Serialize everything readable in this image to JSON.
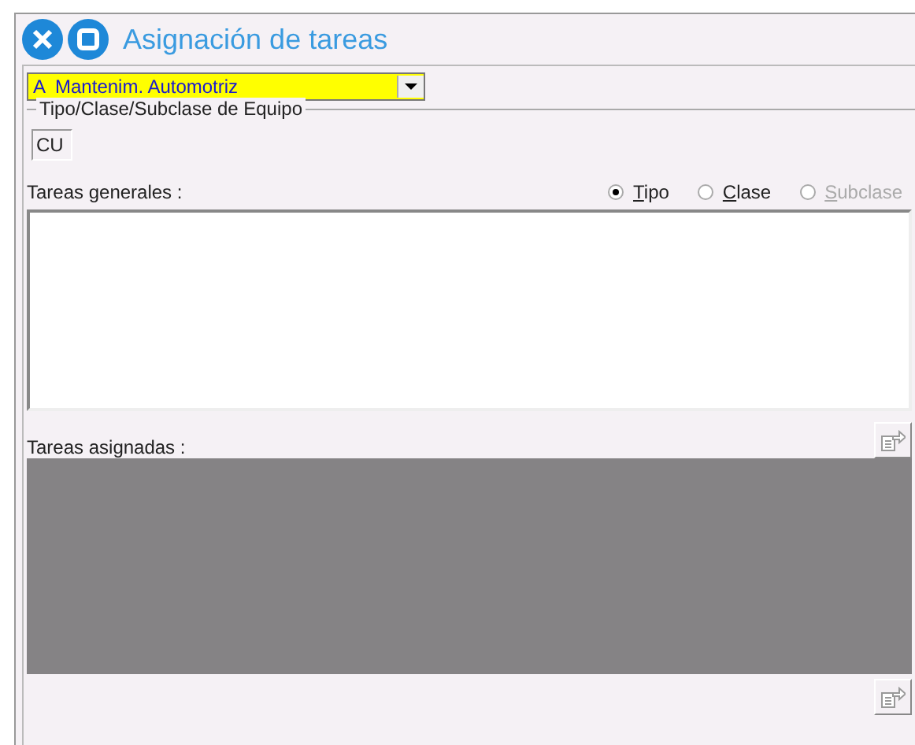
{
  "window": {
    "title": "Asignación de tareas"
  },
  "dropdown": {
    "value": "A  Mantenim. Automotriz"
  },
  "equipment_group": {
    "label": "Tipo/Clase/Subclase de Equipo",
    "value": "CU"
  },
  "general_tasks": {
    "label": "Tareas generales :"
  },
  "radios": [
    {
      "label": "Tipo",
      "selected": true,
      "disabled": false
    },
    {
      "label": "Clase",
      "selected": false,
      "disabled": false
    },
    {
      "label": "Subclase",
      "selected": false,
      "disabled": true
    }
  ],
  "assigned_tasks": {
    "label": "Tareas asignadas :"
  }
}
